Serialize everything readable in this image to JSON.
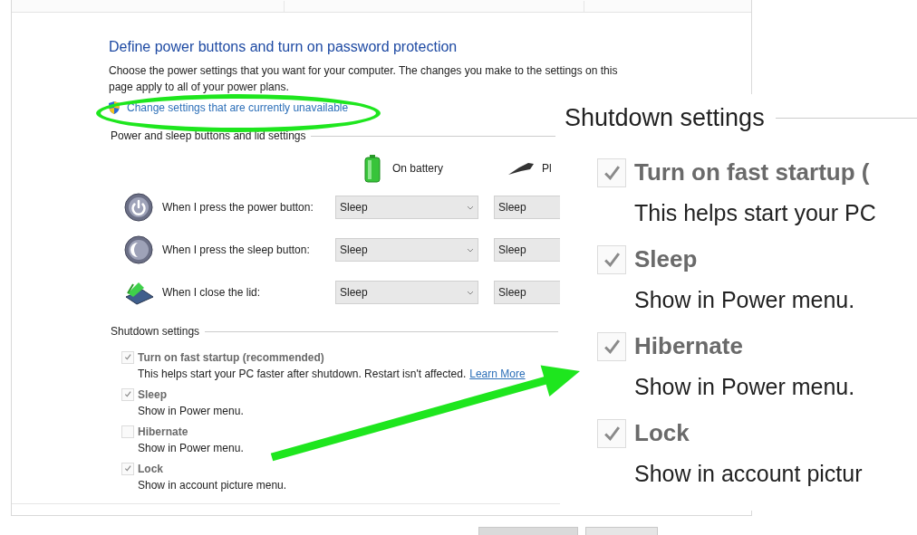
{
  "page_title": "Define power buttons and turn on password protection",
  "description": "Choose the power settings that you want for your computer. The changes you make to the settings on this page apply to all of your power plans.",
  "admin_link": "Change settings that are currently unavailable",
  "power_section": {
    "title": "Power and sleep buttons and lid settings",
    "columns": [
      "On battery",
      "Pl"
    ],
    "rows": [
      {
        "kind": "power",
        "label": "When I press the power button:",
        "on_battery": "Sleep",
        "plugged_in": "Sleep"
      },
      {
        "kind": "sleep",
        "label": "When I press the sleep button:",
        "on_battery": "Sleep",
        "plugged_in": "Sleep"
      },
      {
        "kind": "lid",
        "label": "When I close the lid:",
        "on_battery": "Sleep",
        "plugged_in": "Sleep"
      }
    ]
  },
  "shutdown_section": {
    "title": "Shutdown settings",
    "options": [
      {
        "label": "Turn on fast startup (recommended)",
        "description": "This helps start your PC faster after shutdown. Restart isn't affected.",
        "link": "Learn More",
        "checked": true,
        "disabled": true
      },
      {
        "label": "Sleep",
        "description": "Show in Power menu.",
        "checked": true,
        "disabled": true
      },
      {
        "label": "Hibernate",
        "description": "Show in Power menu.",
        "checked": false,
        "disabled": true
      },
      {
        "label": "Lock",
        "description": "Show in account picture menu.",
        "checked": true,
        "disabled": true
      }
    ]
  },
  "zoom_inset": {
    "title": "Shutdown settings",
    "options": [
      {
        "label": "Turn on fast startup (",
        "description": "This helps start your PC",
        "checked": true,
        "disabled": true
      },
      {
        "label": "Sleep",
        "description": "Show in Power menu.",
        "checked": true,
        "disabled": true
      },
      {
        "label": "Hibernate",
        "description": "Show in Power menu.",
        "checked": true,
        "disabled": true
      },
      {
        "label": "Lock",
        "description": "Show in account pictur",
        "checked": true,
        "disabled": true
      }
    ]
  }
}
